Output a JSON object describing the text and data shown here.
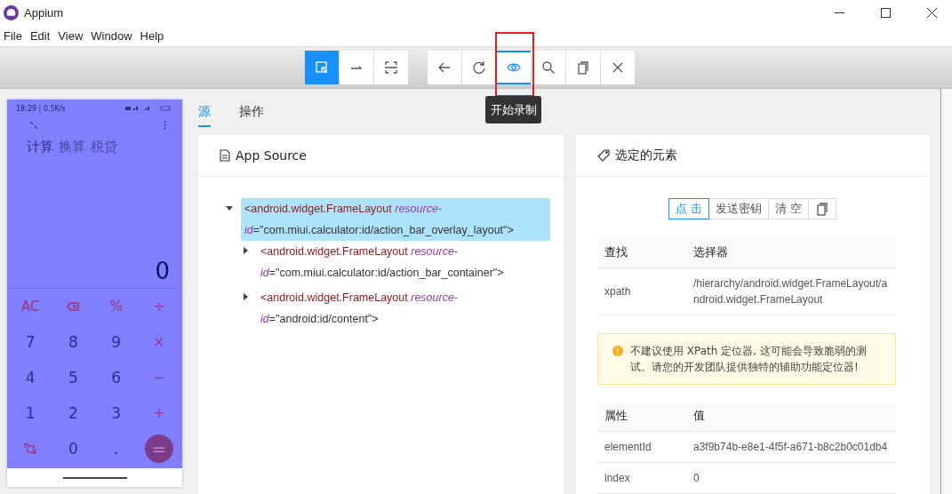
{
  "window": {
    "title": "Appium"
  },
  "menu": [
    "File",
    "Edit",
    "View",
    "Window",
    "Help"
  ],
  "toolbar": {
    "groups": [
      {
        "buttons": [
          {
            "kind": "select",
            "selected": true
          },
          {
            "kind": "swipe",
            "selected": false
          },
          {
            "kind": "tap-area",
            "selected": false
          }
        ]
      },
      {
        "buttons": [
          {
            "kind": "back",
            "selected": false
          },
          {
            "kind": "refresh",
            "selected": false
          },
          {
            "kind": "eye",
            "selected": true
          },
          {
            "kind": "search",
            "selected": false
          },
          {
            "kind": "copy",
            "selected": false
          },
          {
            "kind": "close",
            "selected": false
          }
        ]
      }
    ]
  },
  "tooltip": "开始录制",
  "phone": {
    "status": "18:29 | 0.5K/s",
    "tabs": [
      {
        "label": "计算",
        "selected": true
      },
      {
        "label": "换算",
        "selected": false
      },
      {
        "label": "税贷",
        "selected": false
      }
    ],
    "display": "0",
    "keys": [
      {
        "kind": "op",
        "label": "AC"
      },
      {
        "kind": "backspace"
      },
      {
        "kind": "op",
        "label": "%"
      },
      {
        "kind": "op",
        "label": "÷"
      },
      {
        "kind": "digit",
        "label": "7"
      },
      {
        "kind": "digit",
        "label": "8"
      },
      {
        "kind": "digit",
        "label": "9"
      },
      {
        "kind": "op",
        "label": "×"
      },
      {
        "kind": "digit",
        "label": "4"
      },
      {
        "kind": "digit",
        "label": "5"
      },
      {
        "kind": "digit",
        "label": "6"
      },
      {
        "kind": "op",
        "label": "−"
      },
      {
        "kind": "digit",
        "label": "1"
      },
      {
        "kind": "digit",
        "label": "2"
      },
      {
        "kind": "digit",
        "label": "3"
      },
      {
        "kind": "op",
        "label": "+"
      },
      {
        "kind": "swap"
      },
      {
        "kind": "digit",
        "label": "0"
      },
      {
        "kind": "digit",
        "label": "."
      },
      {
        "kind": "equals",
        "label": "="
      }
    ]
  },
  "tabs": [
    {
      "label": "源",
      "selected": true
    },
    {
      "label": "操作",
      "selected": false
    }
  ],
  "source": {
    "title": "App Source",
    "tree": [
      {
        "tag": "<android.widget.FrameLayout",
        "attr": "resource-id",
        "value": "=\"com.miui.calculator:id/action_bar_overlay_layout\">",
        "selected": true,
        "expanded": true,
        "children": [
          {
            "tag": "<android.widget.FrameLayout",
            "attr": "resource-id",
            "value": "=\"com.miui.calculator:id/action_bar_container\">",
            "selected": false,
            "expanded": false
          },
          {
            "tag": "<android.widget.FrameLayout",
            "attr": "resource-id",
            "value": "=\"android:id/content\">",
            "selected": false,
            "expanded": false
          }
        ]
      }
    ]
  },
  "element": {
    "title": "选定的元素",
    "actions": [
      {
        "kind": "text",
        "label": "点 击",
        "selected": true
      },
      {
        "kind": "text",
        "label": "发送密钥",
        "selected": false
      },
      {
        "kind": "text",
        "label": "清 空",
        "selected": false
      },
      {
        "kind": "copy",
        "selected": false
      }
    ],
    "selector_table": {
      "columns": [
        "查找",
        "选择器"
      ],
      "rows": [
        [
          "xpath",
          "/hierarchy/android.widget.FrameLayout/android.widget.FrameLayout"
        ]
      ]
    },
    "warning": "不建议使用 XPath 定位器, 这可能会导致脆弱的测试。请您的开发团队提供独特的辅助功能定位器!",
    "attr_table": {
      "columns": [
        "属性",
        "值"
      ],
      "rows": [
        [
          "elementId",
          "a3f9b74b-e8e1-4f5f-a671-b8c2b0c01db4"
        ],
        [
          "index",
          "0"
        ]
      ]
    }
  }
}
